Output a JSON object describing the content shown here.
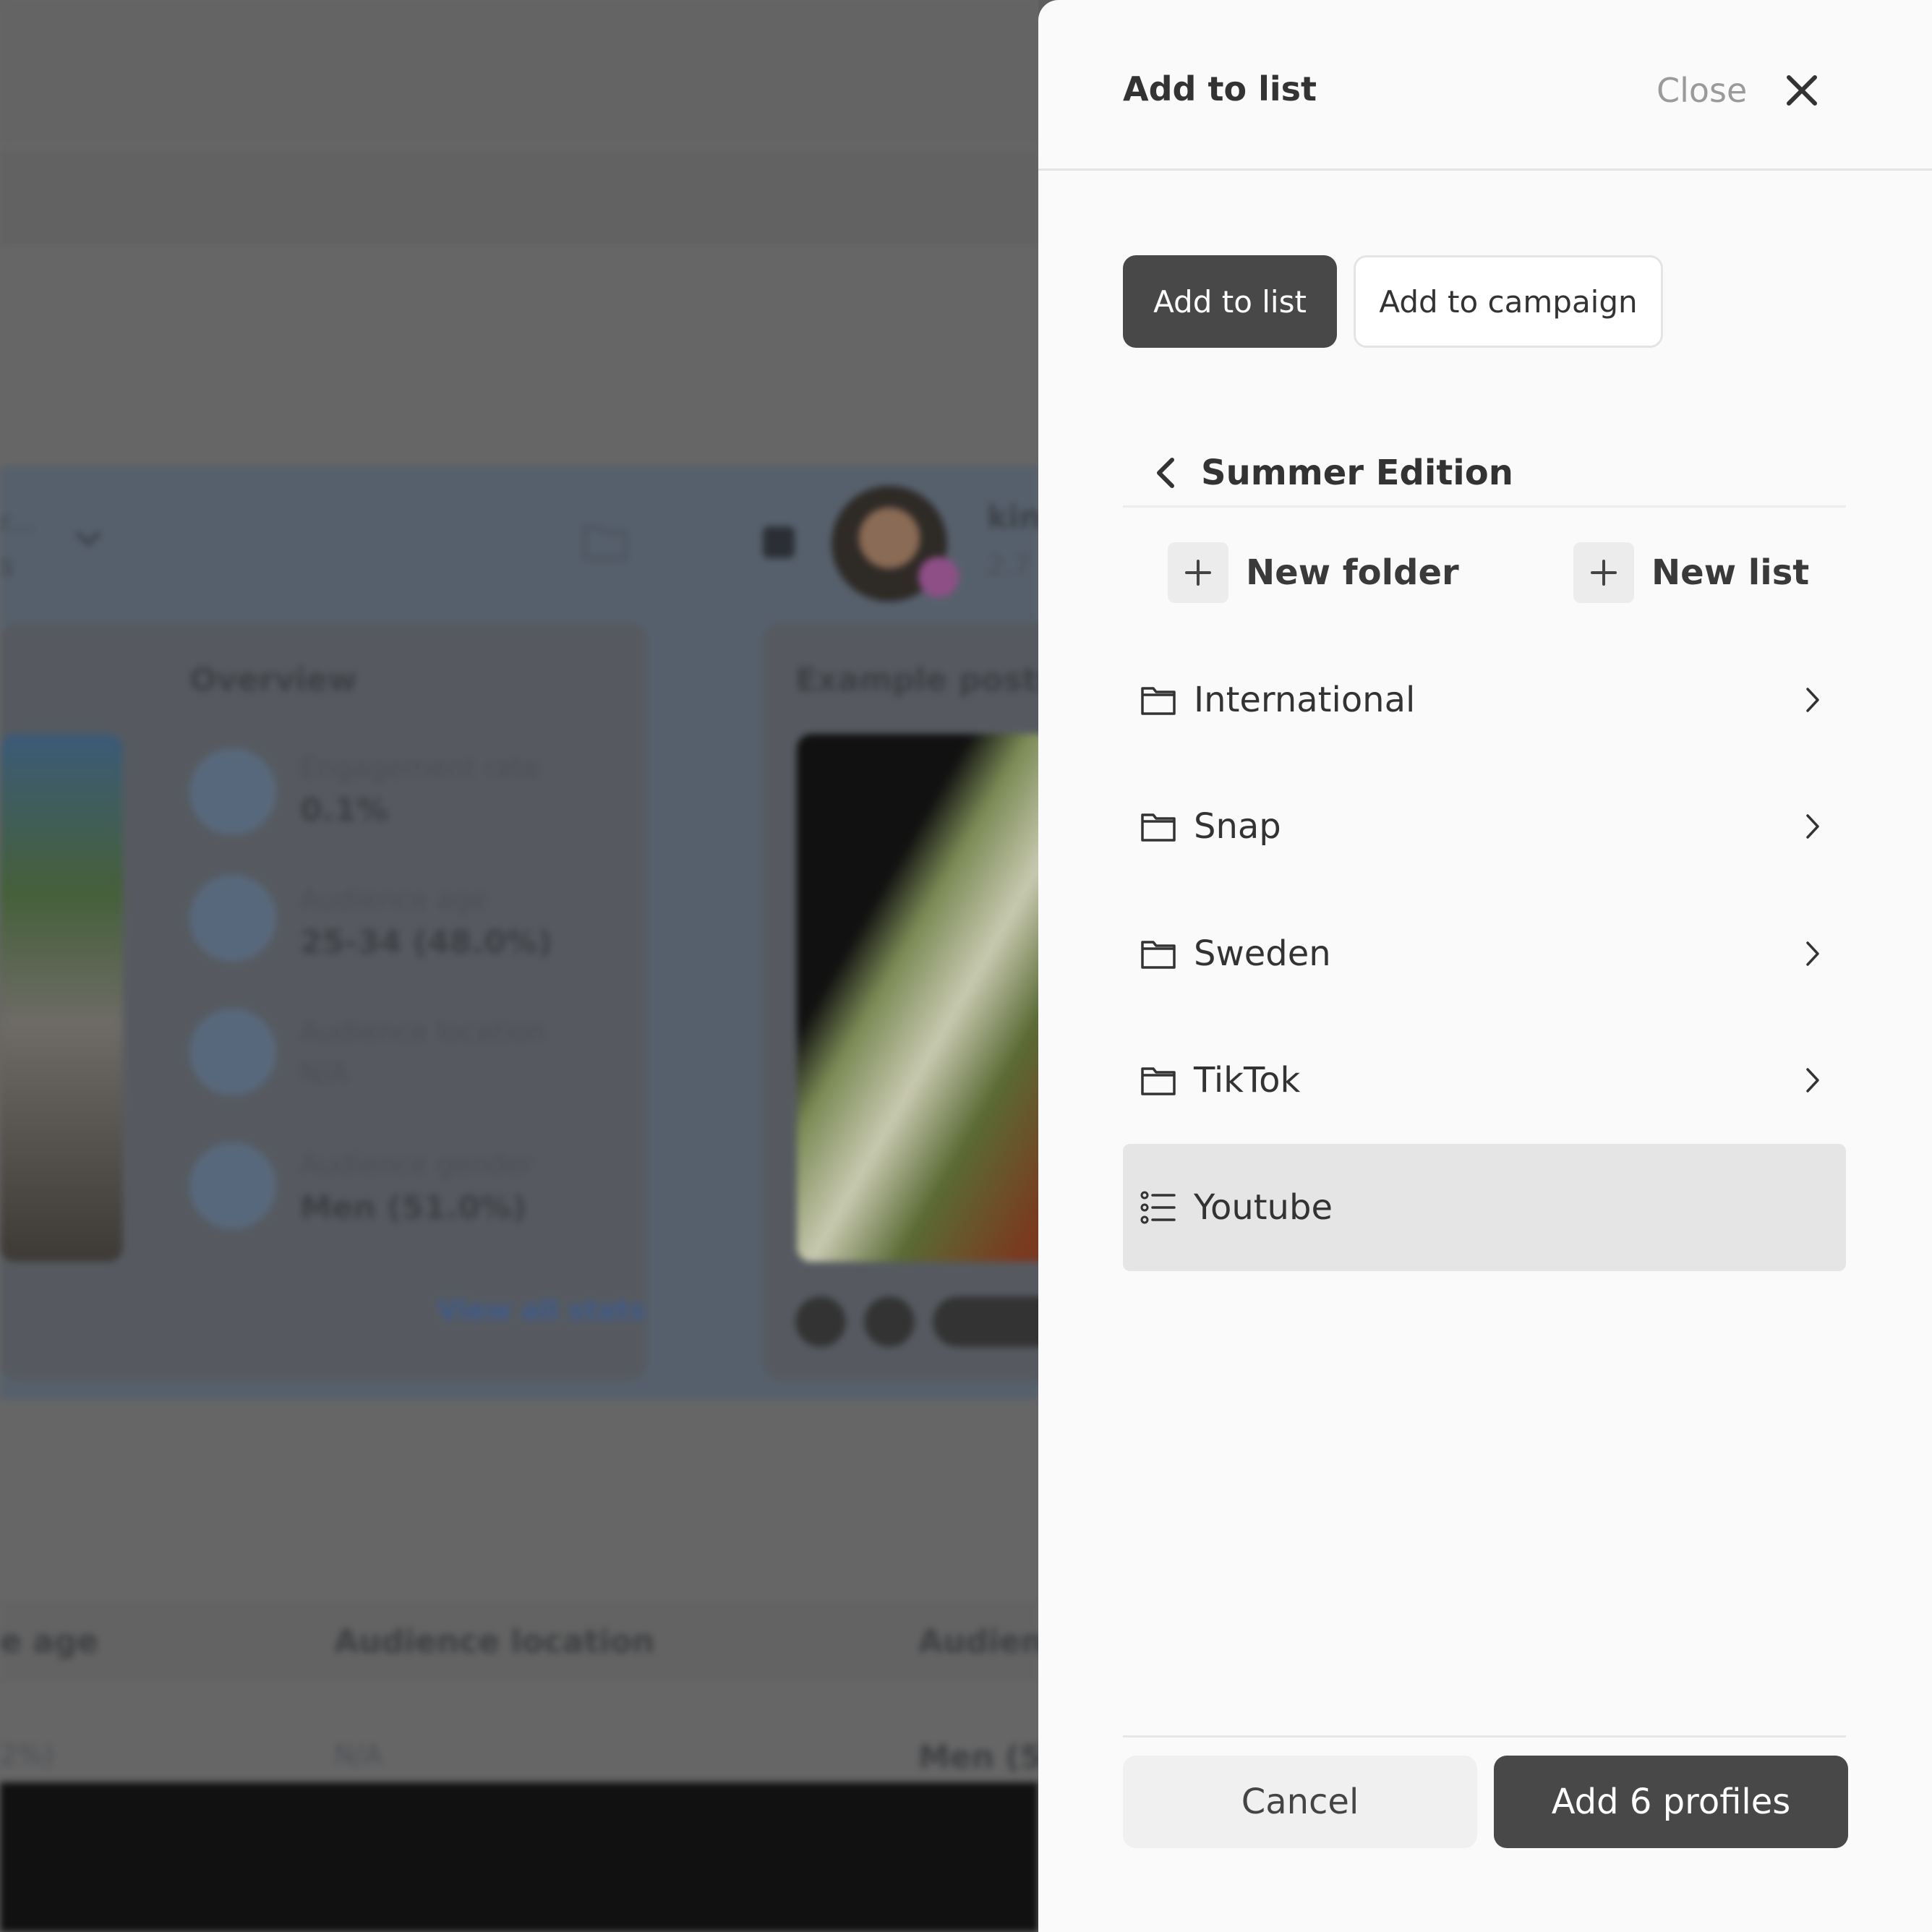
{
  "background": {
    "overview_title": "Overview",
    "example_posts_title": "Example posts",
    "stats": [
      {
        "label": "Engagement rate",
        "value": "0.1%"
      },
      {
        "label": "Audience age",
        "value": "25-34 (48.0%)"
      },
      {
        "label": "Audience location",
        "value": "N/A"
      },
      {
        "label": "Audience gender",
        "value": "Men (51.0%)"
      }
    ],
    "view_all_stats": "View all stats",
    "table_headers": [
      "e age",
      "Audience location",
      "Audien"
    ],
    "table_values": [
      "2%)",
      "N/A",
      "Men (5"
    ],
    "profile_name_partial": "kin",
    "profile_count_partial": "2.7",
    "dropdown_partial_line1": "r...",
    "dropdown_partial_line2": "s"
  },
  "panel": {
    "title": "Add to list",
    "close_label": "Close",
    "tabs": [
      {
        "label": "Add to list",
        "active": true
      },
      {
        "label": "Add to campaign",
        "active": false
      }
    ],
    "breadcrumb": "Summer Edition",
    "new_folder_label": "New folder",
    "new_list_label": "New list",
    "items": [
      {
        "label": "International",
        "type": "folder"
      },
      {
        "label": "Snap",
        "type": "folder"
      },
      {
        "label": "Sweden",
        "type": "folder"
      },
      {
        "label": "TikTok",
        "type": "folder"
      },
      {
        "label": "Youtube",
        "type": "list",
        "selected": true
      }
    ],
    "cancel_label": "Cancel",
    "primary_label": "Add 6 profiles"
  },
  "colors": {
    "primary_button": "#484848",
    "panel_bg": "#fafafa",
    "selected_row": "#e5e5e5",
    "overlay": "#666666"
  }
}
